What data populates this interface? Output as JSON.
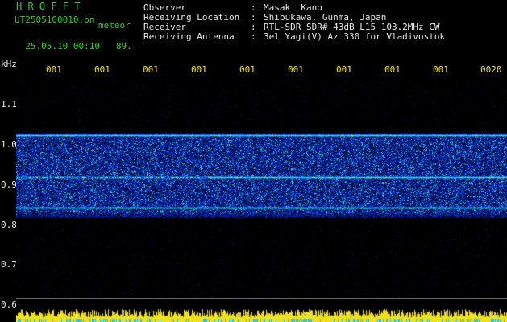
{
  "header": {
    "brand": "H R O F F T",
    "filename": "UT2505100010.pn",
    "meteor_label": "meteor",
    "datetime": "25.05.10 00:10",
    "count": "89.",
    "rows": [
      {
        "label": "Observer",
        "value": "Masaki Kano"
      },
      {
        "label": "Receiving Location",
        "value": "Shibukawa, Gunma, Japan"
      },
      {
        "label": "Receiver",
        "value": "RTL-SDR SDR# 43dB L15 103.2MHz CW"
      },
      {
        "label": "Receiving Antenna",
        "value": "3el Yagi(V) Az 330 for Vladivostok"
      }
    ]
  },
  "axes": {
    "y_unit": "kHz",
    "y_ticks": [
      "1.1",
      "1.0",
      "0.9",
      "0.8",
      "0.7",
      "0.6"
    ],
    "x_ticks": [
      "001",
      "001",
      "001",
      "001",
      "001",
      "001",
      "001",
      "001",
      "001",
      "0020"
    ]
  },
  "colors": {
    "text_green": "#25d02a",
    "text_white": "#e8e8e8",
    "tick_yellow": "#f2e51a",
    "background": "#000000",
    "spectrum_base": "#0a1fa0",
    "baseline_yellow": "#f0e020"
  },
  "spectrum": {
    "freq_min_khz": 0.6,
    "freq_max_khz": 1.15,
    "noise_band_khz": [
      0.82,
      1.03
    ],
    "lines_khz": [
      1.025,
      0.92,
      0.845
    ]
  }
}
